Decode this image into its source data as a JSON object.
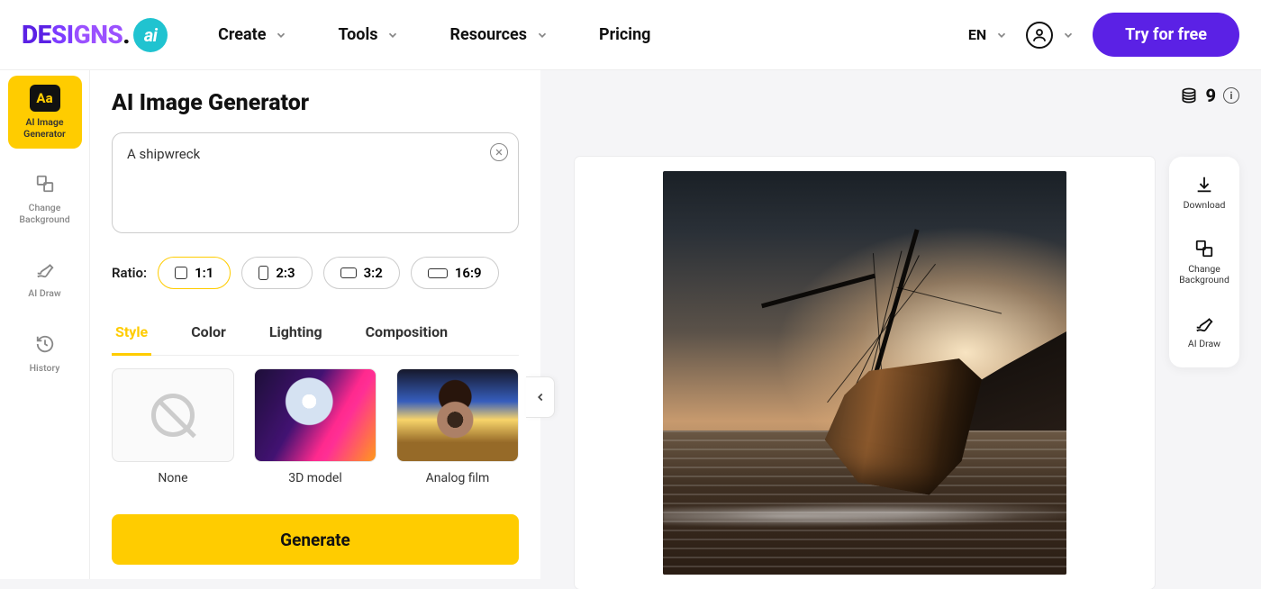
{
  "header": {
    "logo_text": "DESIGNS",
    "logo_badge": "ai",
    "nav": [
      "Create",
      "Tools",
      "Resources",
      "Pricing"
    ],
    "language": "EN",
    "cta": "Try for free"
  },
  "sidebar": {
    "items": [
      {
        "label": "AI Image Generator",
        "icon": "text-icon"
      },
      {
        "label": "Change Background",
        "icon": "layers-icon"
      },
      {
        "label": "AI Draw",
        "icon": "brush-icon"
      },
      {
        "label": "History",
        "icon": "history-icon"
      }
    ]
  },
  "panel": {
    "title": "AI Image Generator",
    "prompt_value": "A shipwreck",
    "prompt_placeholder": "",
    "ratio_label": "Ratio:",
    "ratios": [
      "1:1",
      "2:3",
      "3:2",
      "16:9"
    ],
    "active_ratio": "1:1",
    "tabs": [
      "Style",
      "Color",
      "Lighting",
      "Composition"
    ],
    "active_tab": "Style",
    "styles": [
      {
        "name": "None"
      },
      {
        "name": "3D model"
      },
      {
        "name": "Analog film"
      }
    ],
    "generate_label": "Generate"
  },
  "canvas": {
    "credits_count": "9",
    "output_alt": "shipwreck-result"
  },
  "right_tools": [
    {
      "label": "Download",
      "icon": "download-icon"
    },
    {
      "label": "Change Background",
      "icon": "layers-icon"
    },
    {
      "label": "AI Draw",
      "icon": "brush-icon"
    }
  ]
}
